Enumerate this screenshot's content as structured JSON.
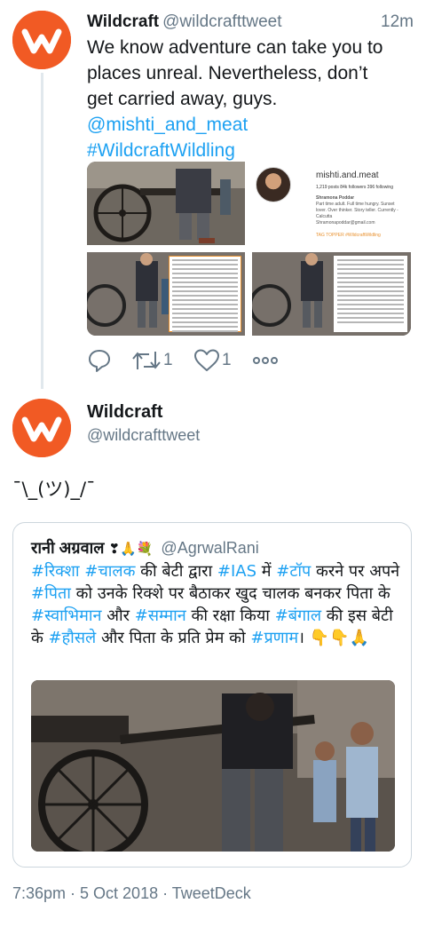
{
  "tweet1": {
    "name": "Wildcraft",
    "handle": "@wildcrafttweet",
    "time": "12m",
    "text_lines": [
      "We know adventure can take you to",
      "places unreal. Nevertheless, don’t",
      "get carried away, guys."
    ],
    "mention": "@mishti_and_meat",
    "hashtag": "#WildcraftWildling",
    "media": {
      "profile_handle": "mishti.and.meat",
      "profile_stats": "1,219 posts    84k followers    396 following",
      "profile_name": "Shramona Poddar",
      "profile_bio": "Part time adult. Full time hungry. Sunset lover. Over thinker. Story teller. Currently - Calcutta",
      "profile_email": "Shramonapoddar@gmail.com",
      "profile_tags": "TAG TOPPER   #WildcraftWildling"
    },
    "actions": {
      "retweets": "1",
      "likes": "1"
    },
    "colors": {
      "brand": "#f15a24",
      "link": "#1da1f2",
      "muted": "#657786"
    }
  },
  "tweet2": {
    "name": "Wildcraft",
    "handle": "@wildcrafttweet",
    "text": "¯\\_(ツ)_/¯",
    "quoted": {
      "name": "रानी अग्रवाल",
      "name_emoji": "❣🙏💐",
      "handle": "@AgrwalRani",
      "text_parts": [
        {
          "t": "#रिक्शा",
          "link": true
        },
        {
          "t": " ",
          "link": false
        },
        {
          "t": "#चालक",
          "link": true
        },
        {
          "t": " की बेटी द्वारा ",
          "link": false
        },
        {
          "t": "#IAS",
          "link": true
        },
        {
          "t": " में ",
          "link": false
        },
        {
          "t": "#टॉप",
          "link": true
        },
        {
          "t": " करने पर अपने ",
          "link": false
        },
        {
          "t": "#पिता",
          "link": true
        },
        {
          "t": " को उनके रिक्शे पर बैठाकर खुद चालक बनकर पिता के ",
          "link": false
        },
        {
          "t": "#स्वाभिमान",
          "link": true
        },
        {
          "t": " और ",
          "link": false
        },
        {
          "t": "#सम्मान",
          "link": true
        },
        {
          "t": " की रक्षा किया ",
          "link": false
        },
        {
          "t": "#बंगाल",
          "link": true
        },
        {
          "t": " की इस बेटी के ",
          "link": false
        },
        {
          "t": "#हौसले",
          "link": true
        },
        {
          "t": " और पिता के प्रति प्रेम को ",
          "link": false
        },
        {
          "t": "#प्रणाम",
          "link": true
        },
        {
          "t": "। 👇👇🙏",
          "link": false
        }
      ]
    }
  },
  "footer": {
    "timestamp": "7:36pm · 5 Oct 2018 · TweetDeck"
  }
}
